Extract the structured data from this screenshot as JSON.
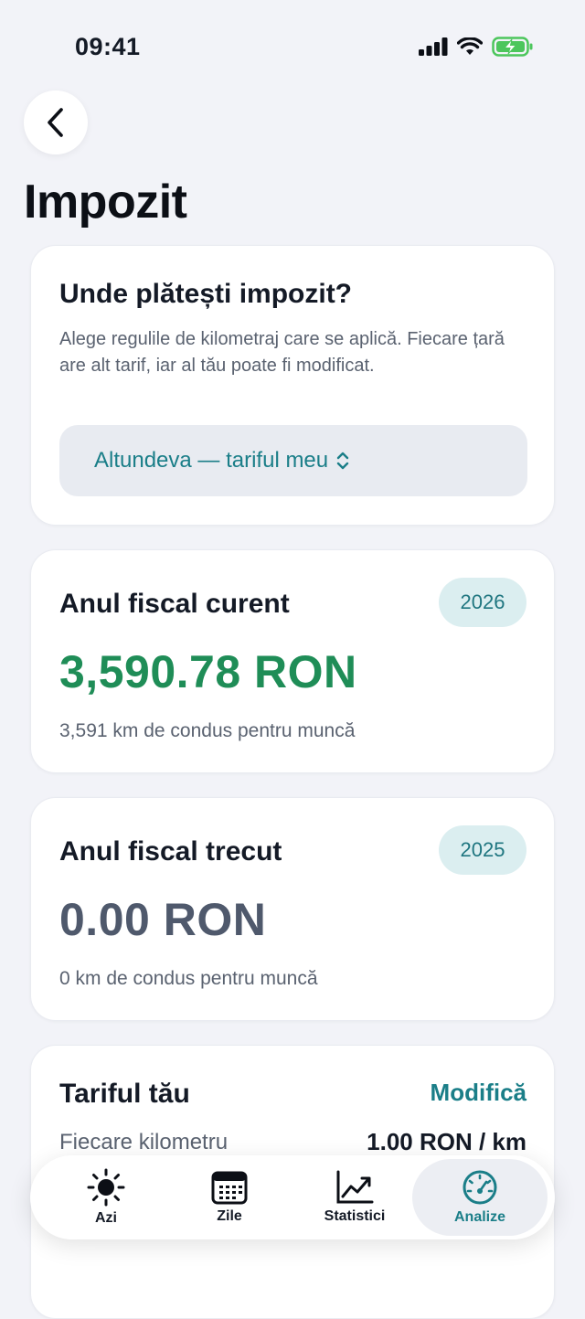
{
  "status_bar": {
    "time": "09:41"
  },
  "header": {
    "title": "Impozit"
  },
  "location_card": {
    "title": "Unde plătești impozit?",
    "description": "Alege regulile de kilometraj care se aplică. Fiecare țară are alt tarif, iar al tău poate fi modificat.",
    "selected_option": "Altundeva — tariful meu"
  },
  "current_year_card": {
    "title": "Anul fiscal curent",
    "year": "2026",
    "amount": "3,590.78 RON",
    "distance_text": "3,591 km de condus pentru muncă"
  },
  "last_year_card": {
    "title": "Anul fiscal trecut",
    "year": "2025",
    "amount": "0.00 RON",
    "distance_text": "0 km de condus pentru muncă"
  },
  "rate_card": {
    "title": "Tariful tău",
    "edit_label": "Modifică",
    "rate_label": "Fiecare kilometru",
    "rate_value": "1.00 RON / km"
  },
  "tab_bar": {
    "tabs": [
      {
        "label": "Azi",
        "icon": "sun-icon"
      },
      {
        "label": "Zile",
        "icon": "calendar-icon"
      },
      {
        "label": "Statistici",
        "icon": "chart-line-icon"
      },
      {
        "label": "Analize",
        "icon": "gauge-icon",
        "active": true
      }
    ]
  },
  "colors": {
    "accent": "#1a7e88",
    "positive": "#1f8d57",
    "background": "#f2f3f8"
  }
}
